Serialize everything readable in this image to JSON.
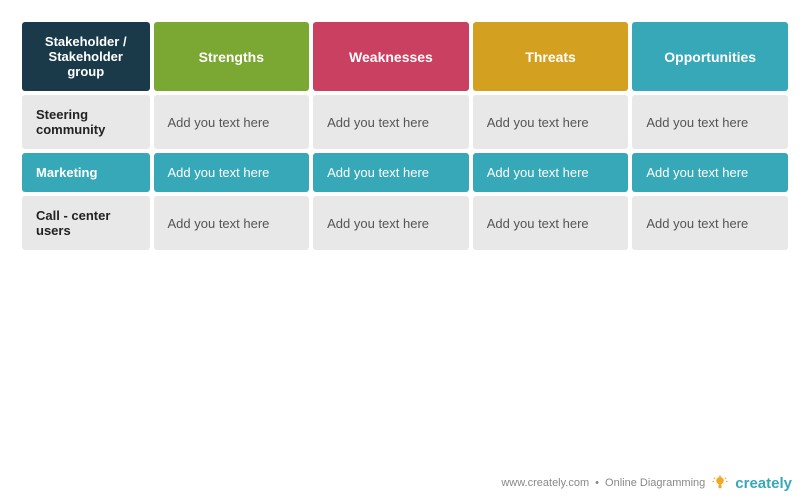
{
  "header": {
    "stakeholder_label": "Stakeholder /\nStakeholder group",
    "strengths_label": "Strengths",
    "weaknesses_label": "Weaknesses",
    "threats_label": "Threats",
    "opportunities_label": "Opportunities"
  },
  "rows": [
    {
      "label": "Steering community",
      "cells": [
        "Add you text here",
        "Add you text here",
        "Add you text here",
        "Add you text here"
      ],
      "style": "light"
    },
    {
      "label": "Marketing",
      "cells": [
        "Add you text here",
        "Add you text here",
        "Add you text here",
        "Add you text here"
      ],
      "style": "teal"
    },
    {
      "label": "Call - center users",
      "cells": [
        "Add you text here",
        "Add you text here",
        "Add you text here",
        "Add you text here"
      ],
      "style": "light"
    }
  ],
  "footer": {
    "url": "www.creately.com",
    "separator": "•",
    "tagline": "Online Diagramming",
    "brand": "creately"
  }
}
